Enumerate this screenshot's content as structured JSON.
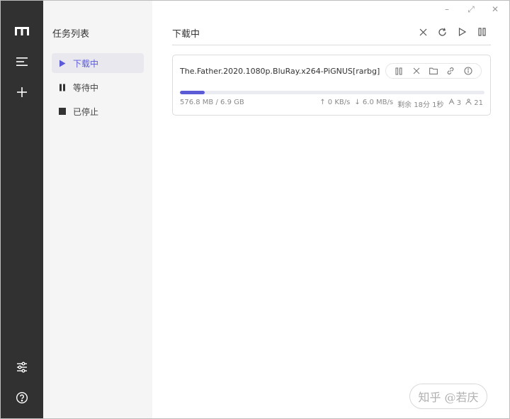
{
  "window_controls": {
    "minimize": "–",
    "maximize": "⤢",
    "close": "✕"
  },
  "rail": {
    "logo_icon": "logo-m-icon",
    "menu_icon": "menu-icon",
    "add_icon": "plus-icon",
    "settings_icon": "sliders-icon",
    "help_icon": "help-circle-icon"
  },
  "tasklist": {
    "title": "任务列表",
    "items": [
      {
        "label": "下载中",
        "icon": "play-icon",
        "active": true
      },
      {
        "label": "等待中",
        "icon": "pause-icon",
        "active": false
      },
      {
        "label": "已停止",
        "icon": "stop-icon",
        "active": false
      }
    ]
  },
  "main": {
    "title": "下载中",
    "toolbar": [
      "close-icon",
      "refresh-icon",
      "play-icon",
      "pause-icon"
    ]
  },
  "task": {
    "name": "The.Father.2020.1080p.BluRay.x264-PiGNUS[rarbg]",
    "size": "576.8 MB / 6.9 GB",
    "progress": 0.082,
    "upload_speed": "↑ 0 KB/s",
    "download_speed": "↓ 6.0 MB/s",
    "remaining": "剩余 18分 1秒",
    "seeders": "3",
    "peers": "21",
    "actions": [
      "pause-icon",
      "close-icon",
      "folder-icon",
      "link-icon",
      "info-icon"
    ]
  },
  "watermark": {
    "text": "知乎 @若庆"
  },
  "colors": {
    "rail_bg": "#313131",
    "tasklist_bg": "#f5f5f5",
    "accent": "#5b5bd6",
    "active_bg": "#e8e8ee"
  }
}
